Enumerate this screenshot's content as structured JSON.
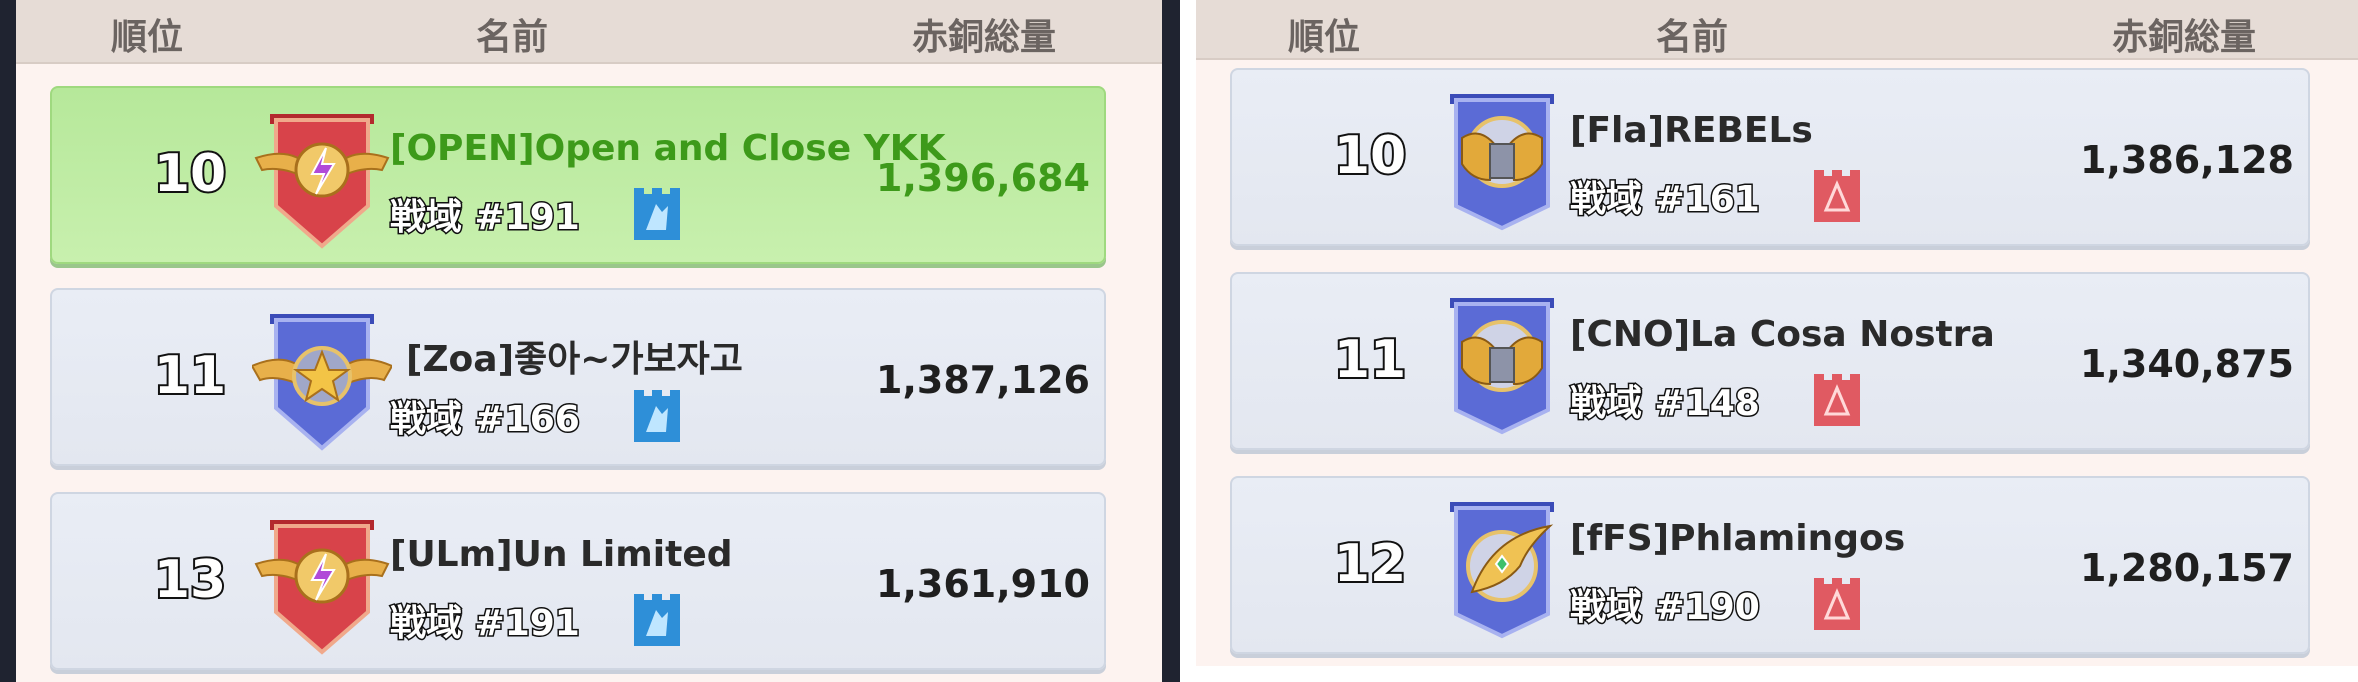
{
  "colors": {
    "panel_bg": "#fdf3f0",
    "header_bg": "#e6dcd6",
    "row_bg": "#e7ebf3",
    "highlight_bg": "#bdeb9f",
    "highlight_text": "#3d9a1a",
    "blue_flag": "#2e8fd8",
    "red_flag": "#e05a62"
  },
  "left": {
    "header": {
      "rank": "順位",
      "name": "名前",
      "total": "赤銅総量"
    },
    "rows": [
      {
        "rank": "10",
        "name": "[OPEN]Open and Close YKK",
        "region": "戦域 #191",
        "score": "1,396,684",
        "emblem": "red-shield-wings-emblem-icon",
        "flag": "blue-flag-icon",
        "highlight": true
      },
      {
        "rank": "11",
        "name": "[Zoa]좋아~가보자고",
        "region": "戦域 #166",
        "score": "1,387,126",
        "emblem": "blue-shield-star-wings-emblem-icon",
        "flag": "blue-flag-icon"
      },
      {
        "rank": "13",
        "name": "[ULm]Un Limited",
        "region": "戦域 #191",
        "score": "1,361,910",
        "emblem": "red-shield-wings-emblem-icon",
        "flag": "blue-flag-icon"
      }
    ]
  },
  "right": {
    "header": {
      "rank": "順位",
      "name": "名前",
      "total": "赤銅総量"
    },
    "rows": [
      {
        "rank": "10",
        "name": "[Fla]REBELs",
        "region": "戦域 #161",
        "score": "1,386,128",
        "emblem": "blue-banner-fists-emblem-icon",
        "flag": "red-flag-icon"
      },
      {
        "rank": "11",
        "name": "[CNO]La Cosa Nostra",
        "region": "戦域 #148",
        "score": "1,340,875",
        "emblem": "blue-banner-fists-emblem-icon",
        "flag": "red-flag-icon"
      },
      {
        "rank": "12",
        "name": "[fFS]Phlamingos",
        "region": "戦域 #190",
        "score": "1,280,157",
        "emblem": "blue-banner-golden-shield-emblem-icon",
        "flag": "red-flag-icon"
      }
    ]
  }
}
